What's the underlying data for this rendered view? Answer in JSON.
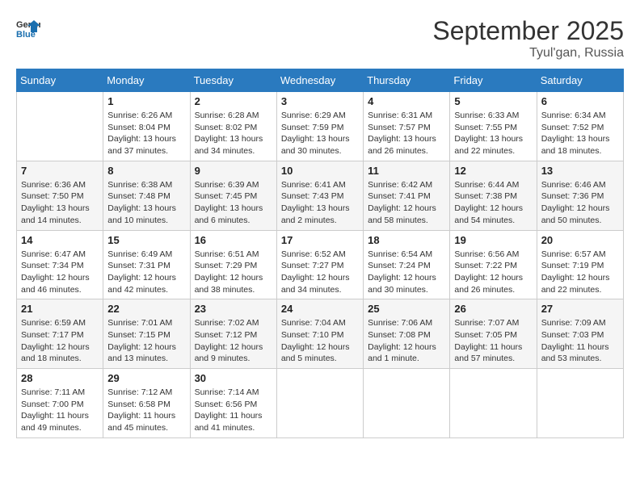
{
  "header": {
    "logo_line1": "General",
    "logo_line2": "Blue",
    "month": "September 2025",
    "location": "Tyul'gan, Russia"
  },
  "days_of_week": [
    "Sunday",
    "Monday",
    "Tuesday",
    "Wednesday",
    "Thursday",
    "Friday",
    "Saturday"
  ],
  "weeks": [
    [
      {
        "day": "",
        "info": ""
      },
      {
        "day": "1",
        "info": "Sunrise: 6:26 AM\nSunset: 8:04 PM\nDaylight: 13 hours\nand 37 minutes."
      },
      {
        "day": "2",
        "info": "Sunrise: 6:28 AM\nSunset: 8:02 PM\nDaylight: 13 hours\nand 34 minutes."
      },
      {
        "day": "3",
        "info": "Sunrise: 6:29 AM\nSunset: 7:59 PM\nDaylight: 13 hours\nand 30 minutes."
      },
      {
        "day": "4",
        "info": "Sunrise: 6:31 AM\nSunset: 7:57 PM\nDaylight: 13 hours\nand 26 minutes."
      },
      {
        "day": "5",
        "info": "Sunrise: 6:33 AM\nSunset: 7:55 PM\nDaylight: 13 hours\nand 22 minutes."
      },
      {
        "day": "6",
        "info": "Sunrise: 6:34 AM\nSunset: 7:52 PM\nDaylight: 13 hours\nand 18 minutes."
      }
    ],
    [
      {
        "day": "7",
        "info": "Sunrise: 6:36 AM\nSunset: 7:50 PM\nDaylight: 13 hours\nand 14 minutes."
      },
      {
        "day": "8",
        "info": "Sunrise: 6:38 AM\nSunset: 7:48 PM\nDaylight: 13 hours\nand 10 minutes."
      },
      {
        "day": "9",
        "info": "Sunrise: 6:39 AM\nSunset: 7:45 PM\nDaylight: 13 hours\nand 6 minutes."
      },
      {
        "day": "10",
        "info": "Sunrise: 6:41 AM\nSunset: 7:43 PM\nDaylight: 13 hours\nand 2 minutes."
      },
      {
        "day": "11",
        "info": "Sunrise: 6:42 AM\nSunset: 7:41 PM\nDaylight: 12 hours\nand 58 minutes."
      },
      {
        "day": "12",
        "info": "Sunrise: 6:44 AM\nSunset: 7:38 PM\nDaylight: 12 hours\nand 54 minutes."
      },
      {
        "day": "13",
        "info": "Sunrise: 6:46 AM\nSunset: 7:36 PM\nDaylight: 12 hours\nand 50 minutes."
      }
    ],
    [
      {
        "day": "14",
        "info": "Sunrise: 6:47 AM\nSunset: 7:34 PM\nDaylight: 12 hours\nand 46 minutes."
      },
      {
        "day": "15",
        "info": "Sunrise: 6:49 AM\nSunset: 7:31 PM\nDaylight: 12 hours\nand 42 minutes."
      },
      {
        "day": "16",
        "info": "Sunrise: 6:51 AM\nSunset: 7:29 PM\nDaylight: 12 hours\nand 38 minutes."
      },
      {
        "day": "17",
        "info": "Sunrise: 6:52 AM\nSunset: 7:27 PM\nDaylight: 12 hours\nand 34 minutes."
      },
      {
        "day": "18",
        "info": "Sunrise: 6:54 AM\nSunset: 7:24 PM\nDaylight: 12 hours\nand 30 minutes."
      },
      {
        "day": "19",
        "info": "Sunrise: 6:56 AM\nSunset: 7:22 PM\nDaylight: 12 hours\nand 26 minutes."
      },
      {
        "day": "20",
        "info": "Sunrise: 6:57 AM\nSunset: 7:19 PM\nDaylight: 12 hours\nand 22 minutes."
      }
    ],
    [
      {
        "day": "21",
        "info": "Sunrise: 6:59 AM\nSunset: 7:17 PM\nDaylight: 12 hours\nand 18 minutes."
      },
      {
        "day": "22",
        "info": "Sunrise: 7:01 AM\nSunset: 7:15 PM\nDaylight: 12 hours\nand 13 minutes."
      },
      {
        "day": "23",
        "info": "Sunrise: 7:02 AM\nSunset: 7:12 PM\nDaylight: 12 hours\nand 9 minutes."
      },
      {
        "day": "24",
        "info": "Sunrise: 7:04 AM\nSunset: 7:10 PM\nDaylight: 12 hours\nand 5 minutes."
      },
      {
        "day": "25",
        "info": "Sunrise: 7:06 AM\nSunset: 7:08 PM\nDaylight: 12 hours\nand 1 minute."
      },
      {
        "day": "26",
        "info": "Sunrise: 7:07 AM\nSunset: 7:05 PM\nDaylight: 11 hours\nand 57 minutes."
      },
      {
        "day": "27",
        "info": "Sunrise: 7:09 AM\nSunset: 7:03 PM\nDaylight: 11 hours\nand 53 minutes."
      }
    ],
    [
      {
        "day": "28",
        "info": "Sunrise: 7:11 AM\nSunset: 7:00 PM\nDaylight: 11 hours\nand 49 minutes."
      },
      {
        "day": "29",
        "info": "Sunrise: 7:12 AM\nSunset: 6:58 PM\nDaylight: 11 hours\nand 45 minutes."
      },
      {
        "day": "30",
        "info": "Sunrise: 7:14 AM\nSunset: 6:56 PM\nDaylight: 11 hours\nand 41 minutes."
      },
      {
        "day": "",
        "info": ""
      },
      {
        "day": "",
        "info": ""
      },
      {
        "day": "",
        "info": ""
      },
      {
        "day": "",
        "info": ""
      }
    ]
  ]
}
